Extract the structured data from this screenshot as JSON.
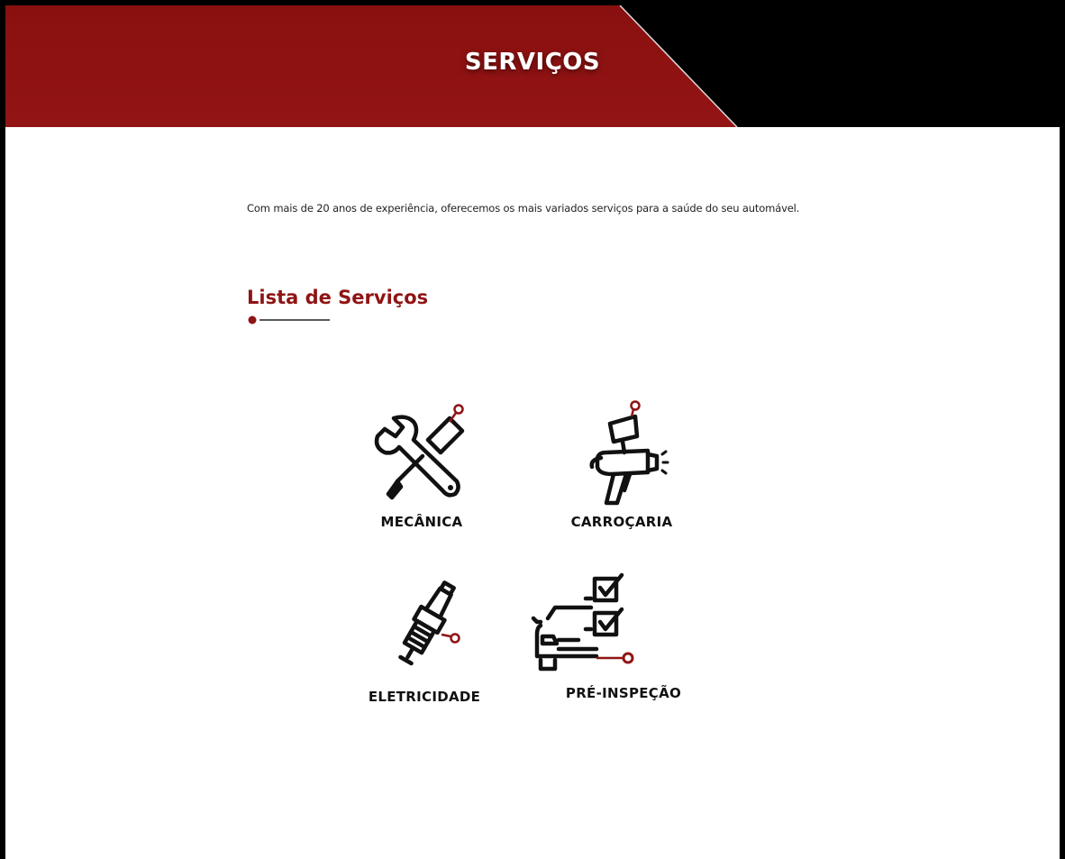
{
  "banner": {
    "title": "SERVIÇOS"
  },
  "intro": {
    "text": "Com mais de 20 anos de experiência, oferecemos os mais variados serviços para a saúde do seu automável."
  },
  "services_section": {
    "title": "Lista de Serviços",
    "items": [
      {
        "label": "MECÂNICA",
        "icon": "wrench-screwdriver-icon"
      },
      {
        "label": "CARROÇARIA",
        "icon": "spray-gun-icon"
      },
      {
        "label": "ELETRICIDADE",
        "icon": "spark-plug-icon"
      },
      {
        "label": "PRÉ-INSPEÇÃO",
        "icon": "car-checklist-icon"
      }
    ]
  },
  "colors": {
    "brand_red": "#8f1414",
    "black": "#000000",
    "white": "#ffffff"
  }
}
